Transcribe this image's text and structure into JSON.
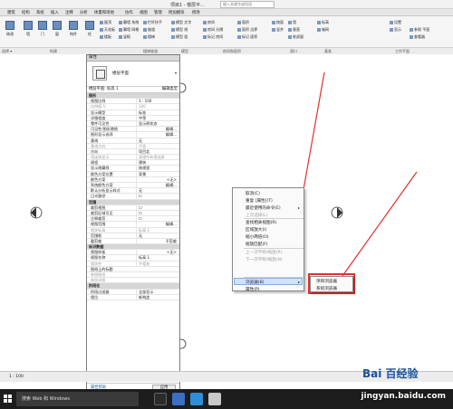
{
  "titlebar": {
    "title": "项目1 - 楼层平...",
    "search_placeholder": "键入关键字或短语"
  },
  "menu": [
    "建筑",
    "结构",
    "系统",
    "插入",
    "注释",
    "分析",
    "体量和场地",
    "协作",
    "视图",
    "管理",
    "附加模块",
    "修改"
  ],
  "ribbon": {
    "modify": "修改",
    "wall": "墙",
    "door": "门",
    "window": "窗",
    "component": "构件",
    "column": "柱",
    "small_items": [
      "屋顶",
      "天花板",
      "楼板",
      "幕墙 系统",
      "幕墙 网格",
      "竖梃",
      "栏杆扶手",
      "坡道",
      "楼梯",
      "模型 文字",
      "模型 线",
      "模型 组",
      "房间",
      "房间 分隔",
      "标记 房间",
      "面积",
      "面积 边界",
      "标记 面积",
      "按面",
      "竖井",
      "墙",
      "垂直",
      "老虎窗",
      "标高",
      "轴网",
      "设置",
      "显示",
      "参照 平面",
      "查看器"
    ],
    "groups": [
      "选择",
      "构建",
      "楼梯坡道",
      "模型",
      "房间和面积",
      "洞口",
      "基准",
      "工作平面"
    ],
    "select_label": "选择 ▾"
  },
  "properties": {
    "header": "属性",
    "type_name": "楼层平面",
    "selector": "楼层平面: 标高 1",
    "edit_type": "编辑类型",
    "help_link": "属性帮助",
    "apply": "应用",
    "rows": [
      {
        "k": "图形",
        "v": "",
        "t": "sec"
      },
      {
        "k": "视图比例",
        "v": "1 : 100",
        "t": ""
      },
      {
        "k": "比例值 1:",
        "v": "100",
        "t": "dis"
      },
      {
        "k": "显示模型",
        "v": "标准",
        "t": ""
      },
      {
        "k": "详细程度",
        "v": "中等",
        "t": ""
      },
      {
        "k": "零件可见性",
        "v": "显示原状态",
        "t": ""
      },
      {
        "k": "可见性/图形替换",
        "v": "编辑...",
        "t": "btn"
      },
      {
        "k": "图形显示选项",
        "v": "编辑...",
        "t": "btn"
      },
      {
        "k": "基线",
        "v": "无",
        "t": ""
      },
      {
        "k": "基线方向",
        "v": "平面",
        "t": "dis"
      },
      {
        "k": "方向",
        "v": "项目北",
        "t": ""
      },
      {
        "k": "墙连接显示",
        "v": "清理所有墙连接",
        "t": "dis"
      },
      {
        "k": "规程",
        "v": "建筑",
        "t": ""
      },
      {
        "k": "显示隐藏线",
        "v": "按规程",
        "t": ""
      },
      {
        "k": "颜色方案位置",
        "v": "背景",
        "t": ""
      },
      {
        "k": "颜色方案",
        "v": "<无>",
        "t": "btn"
      },
      {
        "k": "系统颜色方案",
        "v": "编辑...",
        "t": "btn"
      },
      {
        "k": "默认分析显示样式",
        "v": "无",
        "t": ""
      },
      {
        "k": "日光路径",
        "v": "☐",
        "t": ""
      },
      {
        "k": "范围",
        "v": "",
        "t": "sec"
      },
      {
        "k": "裁剪视图",
        "v": "☐",
        "t": ""
      },
      {
        "k": "裁剪区域可见",
        "v": "☐",
        "t": ""
      },
      {
        "k": "注释裁剪",
        "v": "☐",
        "t": ""
      },
      {
        "k": "视图范围",
        "v": "编辑...",
        "t": "btn"
      },
      {
        "k": "相关标高",
        "v": "标高 1",
        "t": "dis"
      },
      {
        "k": "范围框",
        "v": "无",
        "t": ""
      },
      {
        "k": "截剪裁",
        "v": "不剪裁",
        "t": "btn"
      },
      {
        "k": "标识数据",
        "v": "",
        "t": "sec"
      },
      {
        "k": "视图样板",
        "v": "<无>",
        "t": "btn"
      },
      {
        "k": "视图名称",
        "v": "标高 1",
        "t": ""
      },
      {
        "k": "相关性",
        "v": "不相关",
        "t": "dis"
      },
      {
        "k": "图纸上的标题",
        "v": "",
        "t": ""
      },
      {
        "k": "参照图纸",
        "v": "",
        "t": "dis"
      },
      {
        "k": "参照详图",
        "v": "",
        "t": "dis"
      },
      {
        "k": "阶段化",
        "v": "",
        "t": "sec"
      },
      {
        "k": "阶段过滤器",
        "v": "全部显示",
        "t": ""
      },
      {
        "k": "相位",
        "v": "新构造",
        "t": ""
      }
    ]
  },
  "context_menu": [
    {
      "label": "取消(C)",
      "dis": false
    },
    {
      "label": "重复 [属性](T)",
      "dis": false
    },
    {
      "label": "最近使用的命令(E)",
      "dis": false
    },
    {
      "label": "上次选择(L)",
      "dis": true
    },
    {
      "label": "查找相关视图(R)",
      "dis": false
    },
    {
      "label": "区域放大(I)",
      "dis": false
    },
    {
      "label": "缩小两倍(O)",
      "dis": false
    },
    {
      "label": "缩放匹配(F)",
      "dis": false
    },
    {
      "label": "上一次平移/缩放(R)",
      "dis": true
    },
    {
      "label": "下一次平移/缩放(N)",
      "dis": true
    },
    {
      "label": "浏览器(B)",
      "dis": false
    },
    {
      "label": "属性(P)",
      "dis": false
    }
  ],
  "submenu": [
    "项目浏览器",
    "系统浏览器"
  ],
  "statusbar": {
    "scale": "1 : 100"
  },
  "taskbar": {
    "search": "搜索 Web 和 Windows"
  },
  "watermark": {
    "text": "jingyan.baidu.com",
    "logo": "Bai 百经验"
  },
  "colors": {
    "highlight": "#cfe3f7",
    "annotation": "#e0312f",
    "taskbar": "#1d1d1d"
  }
}
